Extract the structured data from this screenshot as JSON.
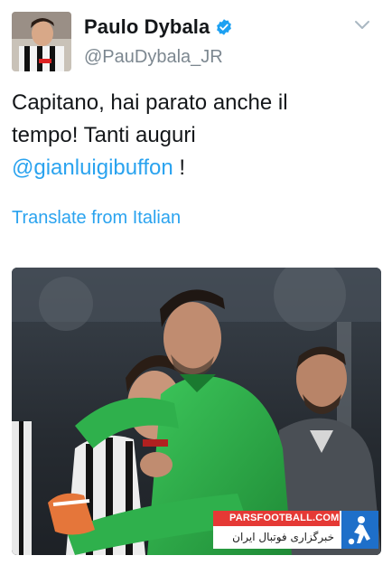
{
  "profile": {
    "display_name": "Paulo Dybala",
    "handle": "@PauDybala_JR"
  },
  "tweet": {
    "text_line1": "Capitano, hai parato anche il",
    "text_line2": "tempo! Tanti auguri",
    "mention": "@gianluigibuffon",
    "text_end": " !",
    "translate_link": "Translate from Italian"
  },
  "watermark": {
    "site": "PARSFOOTBALL.COM",
    "persian": "خبرگزاری فوتبال ایران"
  },
  "colors": {
    "link": "#2aa3ef",
    "text": "#14171a",
    "muted": "#7c8790",
    "verified": "#1da1f2"
  }
}
